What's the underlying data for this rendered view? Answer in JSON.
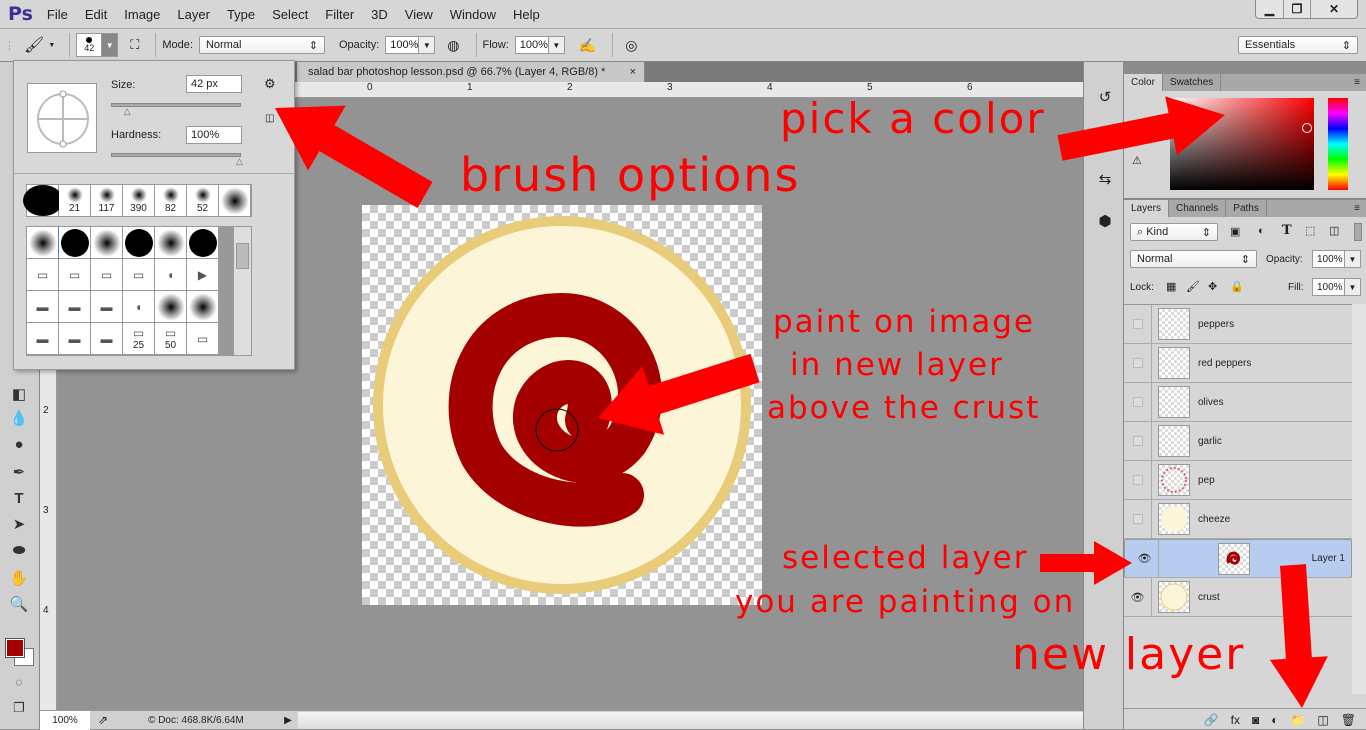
{
  "app": {
    "logo": "Ps",
    "menu": [
      "File",
      "Edit",
      "Image",
      "Layer",
      "Type",
      "Select",
      "Filter",
      "3D",
      "View",
      "Window",
      "Help"
    ],
    "window_buttons": [
      "minimize",
      "restore",
      "close"
    ]
  },
  "options": {
    "brush_size": "42",
    "mode_label": "Mode:",
    "mode_value": "Normal",
    "opacity_label": "Opacity:",
    "opacity_value": "100%",
    "flow_label": "Flow:",
    "flow_value": "100%",
    "workspace": "Essentials"
  },
  "document": {
    "tab_title": "salad bar photoshop lesson.psd @ 66.7% (Layer 4, RGB/8) *",
    "close": "×",
    "ruler_top": [
      "0",
      "1",
      "2",
      "3",
      "4",
      "5",
      "6"
    ],
    "ruler_left": [
      "1",
      "2",
      "3",
      "4"
    ],
    "zoom": "100%",
    "doc_info": "© Doc: 468.8K/6.64M"
  },
  "brush_popup": {
    "size_label": "Size:",
    "size_value": "42 px",
    "hardness_label": "Hardness:",
    "hardness_value": "100%",
    "size_slider": 0.12,
    "hardness_slider": 1.0,
    "presets": [
      "",
      "21",
      "117",
      "390",
      "82",
      "52",
      ""
    ],
    "grid_labels": [
      "",
      "",
      "",
      "",
      "",
      "",
      "",
      "",
      "",
      "",
      "",
      "",
      "",
      "",
      "",
      "",
      "",
      "",
      "",
      "",
      "",
      "25",
      "50",
      ""
    ]
  },
  "color_panel": {
    "tabs": [
      "Color",
      "Swatches"
    ],
    "foreground": "#a50000",
    "background": "#ffffff"
  },
  "layers_panel": {
    "tabs": [
      "Layers",
      "Channels",
      "Paths"
    ],
    "filter": "Kind",
    "blend": "Normal",
    "opacity_label": "Opacity:",
    "opacity": "100%",
    "lock_label": "Lock:",
    "fill_label": "Fill:",
    "fill": "100%",
    "layers": [
      {
        "name": "peppers",
        "visible": false,
        "selected": false
      },
      {
        "name": "red peppers",
        "visible": false,
        "selected": false
      },
      {
        "name": "olives",
        "visible": false,
        "selected": false
      },
      {
        "name": "garlic",
        "visible": false,
        "selected": false
      },
      {
        "name": "pep",
        "visible": false,
        "selected": false
      },
      {
        "name": "cheeze",
        "visible": false,
        "selected": false
      },
      {
        "name": "Layer 1",
        "visible": true,
        "selected": true
      },
      {
        "name": "crust",
        "visible": true,
        "selected": false
      }
    ],
    "bottom_icons": [
      "link-icon",
      "fx-icon",
      "mask-icon",
      "adjustment-icon",
      "folder-icon",
      "new-layer-icon",
      "trash-icon"
    ]
  },
  "annotations": {
    "brush_options": "brush options",
    "pick_color": "pick a color",
    "paint_line1": "paint on image",
    "paint_line2": "in new layer",
    "paint_line3": "above the crust",
    "selected_line1": "selected layer",
    "selected_line2": "you are painting on",
    "new_layer": "new layer"
  },
  "colors": {
    "annotation": "#ff0000",
    "paint": "#a50000",
    "crust": "#fdf5d8",
    "crust_edge": "#e8cc7a",
    "selected_layer": "#b6cdf0"
  }
}
